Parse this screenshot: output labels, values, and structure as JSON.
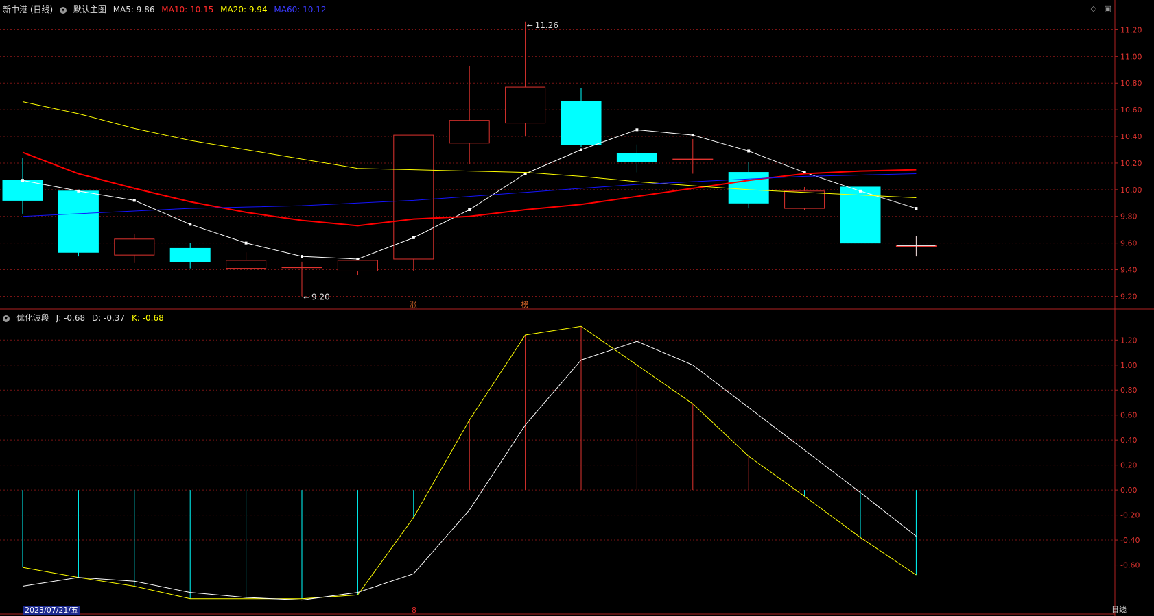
{
  "header": {
    "title": "新中港 (日线)",
    "main_chart_label": "默认主图",
    "ma5": "MA5: 9.86",
    "ma10": "MA10: 10.15",
    "ma20": "MA20: 9.94",
    "ma60": "MA60: 10.12"
  },
  "indicator_header": {
    "name": "优化波段",
    "j": "J: -0.68",
    "d": "D: -0.37",
    "k": "K: -0.68"
  },
  "icons": [
    "diamond-icon",
    "maximize-icon"
  ],
  "footer": {
    "date": "2023/07/21/五",
    "period": "日线",
    "marker": "8"
  },
  "colors": {
    "up": "#e0332f",
    "down": "#00ffff",
    "ma5": "#ffffff",
    "ma10": "#ff0000",
    "ma20": "#ffff00",
    "ma60": "#1414ff",
    "grid": "#7a1414",
    "axis": "#b22222"
  },
  "chart_data": [
    {
      "type": "candlestick",
      "y_axis_ticks": [
        "11.20",
        "11.00",
        "10.80",
        "10.60",
        "10.40",
        "10.20",
        "10.00",
        "9.80",
        "9.60",
        "9.40",
        "9.20"
      ],
      "ylim": [
        9.12,
        11.3
      ],
      "candles": [
        {
          "o": 10.07,
          "h": 10.24,
          "l": 9.82,
          "c": 9.92
        },
        {
          "o": 9.99,
          "h": 10.0,
          "l": 9.5,
          "c": 9.53
        },
        {
          "o": 9.51,
          "h": 9.67,
          "l": 9.45,
          "c": 9.63
        },
        {
          "o": 9.56,
          "h": 9.6,
          "l": 9.41,
          "c": 9.46
        },
        {
          "o": 9.41,
          "h": 9.53,
          "l": 9.39,
          "c": 9.47
        },
        {
          "o": 9.42,
          "h": 9.46,
          "l": 9.2,
          "c": 9.42
        },
        {
          "o": 9.39,
          "h": 9.48,
          "l": 9.36,
          "c": 9.47
        },
        {
          "o": 9.48,
          "h": 10.41,
          "l": 9.39,
          "c": 10.41
        },
        {
          "o": 10.35,
          "h": 10.93,
          "l": 10.19,
          "c": 10.52
        },
        {
          "o": 10.5,
          "h": 11.26,
          "l": 10.4,
          "c": 10.77
        },
        {
          "o": 10.66,
          "h": 10.76,
          "l": 10.32,
          "c": 10.34
        },
        {
          "o": 10.27,
          "h": 10.34,
          "l": 10.13,
          "c": 10.21
        },
        {
          "o": 10.23,
          "h": 10.38,
          "l": 10.12,
          "c": 10.23
        },
        {
          "o": 10.13,
          "h": 10.21,
          "l": 9.86,
          "c": 9.9
        },
        {
          "o": 9.86,
          "h": 10.02,
          "l": 9.85,
          "c": 9.99
        },
        {
          "o": 10.02,
          "h": 10.02,
          "l": 9.6,
          "c": 9.6
        },
        {
          "o": 9.58,
          "h": 9.65,
          "l": 9.5,
          "c": 9.58
        }
      ],
      "series": [
        {
          "name": "MA5",
          "values": [
            10.07,
            9.99,
            9.92,
            9.74,
            9.6,
            9.5,
            9.48,
            9.64,
            9.85,
            10.12,
            10.3,
            10.45,
            10.41,
            10.29,
            10.13,
            9.99,
            9.86
          ]
        },
        {
          "name": "MA10",
          "values": [
            10.28,
            10.12,
            10.01,
            9.91,
            9.83,
            9.77,
            9.73,
            9.78,
            9.8,
            9.85,
            9.89,
            9.95,
            10.01,
            10.07,
            10.12,
            10.14,
            10.15
          ]
        },
        {
          "name": "MA20",
          "values": [
            10.66,
            10.57,
            10.46,
            10.37,
            10.3,
            10.23,
            10.16,
            10.15,
            10.14,
            10.13,
            10.1,
            10.06,
            10.03,
            10.0,
            9.98,
            9.96,
            9.94
          ]
        },
        {
          "name": "MA60",
          "values": [
            9.8,
            9.82,
            9.84,
            9.86,
            9.87,
            9.88,
            9.9,
            9.92,
            9.95,
            9.98,
            10.01,
            10.04,
            10.06,
            10.08,
            10.1,
            10.11,
            10.12
          ]
        }
      ],
      "annotations": [
        {
          "text": "11.26",
          "index": 9,
          "value": 11.26
        },
        {
          "text": "9.20",
          "index": 5,
          "value": 9.2
        },
        {
          "text": "涨",
          "index": 7
        },
        {
          "text": "榜",
          "index": 9
        }
      ]
    },
    {
      "type": "line",
      "name": "优化波段",
      "y_axis_ticks": [
        "1.20",
        "1.00",
        "0.80",
        "0.60",
        "0.40",
        "0.20",
        "0.00",
        "-0.20",
        "-0.40",
        "-0.60"
      ],
      "ylim": [
        -0.97,
        1.41
      ],
      "series": [
        {
          "name": "J",
          "values": [
            -0.62,
            -0.7,
            -0.77,
            -0.87,
            -0.87,
            -0.87,
            -0.84,
            -0.22,
            0.56,
            1.24,
            1.31,
            1.0,
            0.69,
            0.27,
            -0.05,
            -0.38,
            -0.68
          ]
        },
        {
          "name": "K",
          "values": [
            -0.77,
            -0.7,
            -0.73,
            -0.82,
            -0.86,
            -0.88,
            -0.82,
            -0.67,
            -0.16,
            0.52,
            1.04,
            1.19,
            1.0,
            0.66,
            0.32,
            -0.02,
            -0.37
          ]
        },
        {
          "name": "bars",
          "values": [
            -0.62,
            -0.7,
            -0.77,
            -0.87,
            -0.87,
            -0.87,
            -0.84,
            -0.22,
            0.56,
            1.24,
            1.31,
            1.0,
            0.69,
            0.27,
            -0.05,
            -0.38,
            -0.68
          ]
        }
      ]
    }
  ]
}
